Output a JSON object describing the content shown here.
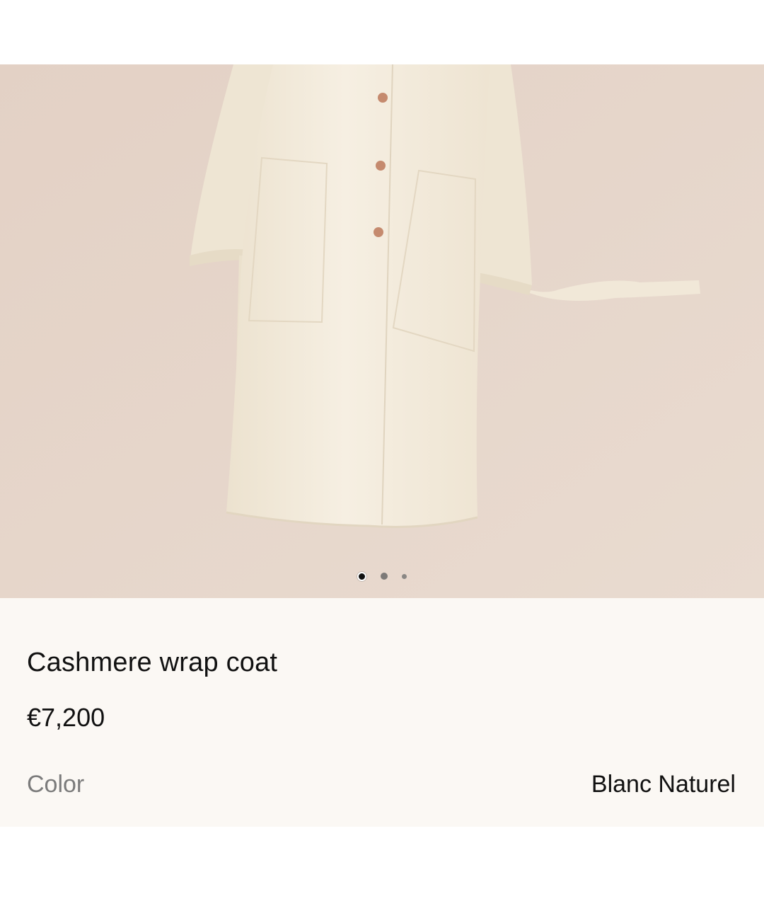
{
  "product": {
    "image_alt": "Cashmere wrap coat",
    "title": "Cashmere wrap coat",
    "price": "€7,200",
    "color_label": "Color",
    "color_value": "Blanc Naturel"
  },
  "carousel": {
    "page_count": 3,
    "active_index": 0
  },
  "colors": {
    "image_background": "#e6d6cb",
    "coat": "#f3ebdc",
    "panel_background": "#fbf8f4",
    "text_primary": "#111111",
    "text_secondary": "#7b7b7b"
  }
}
